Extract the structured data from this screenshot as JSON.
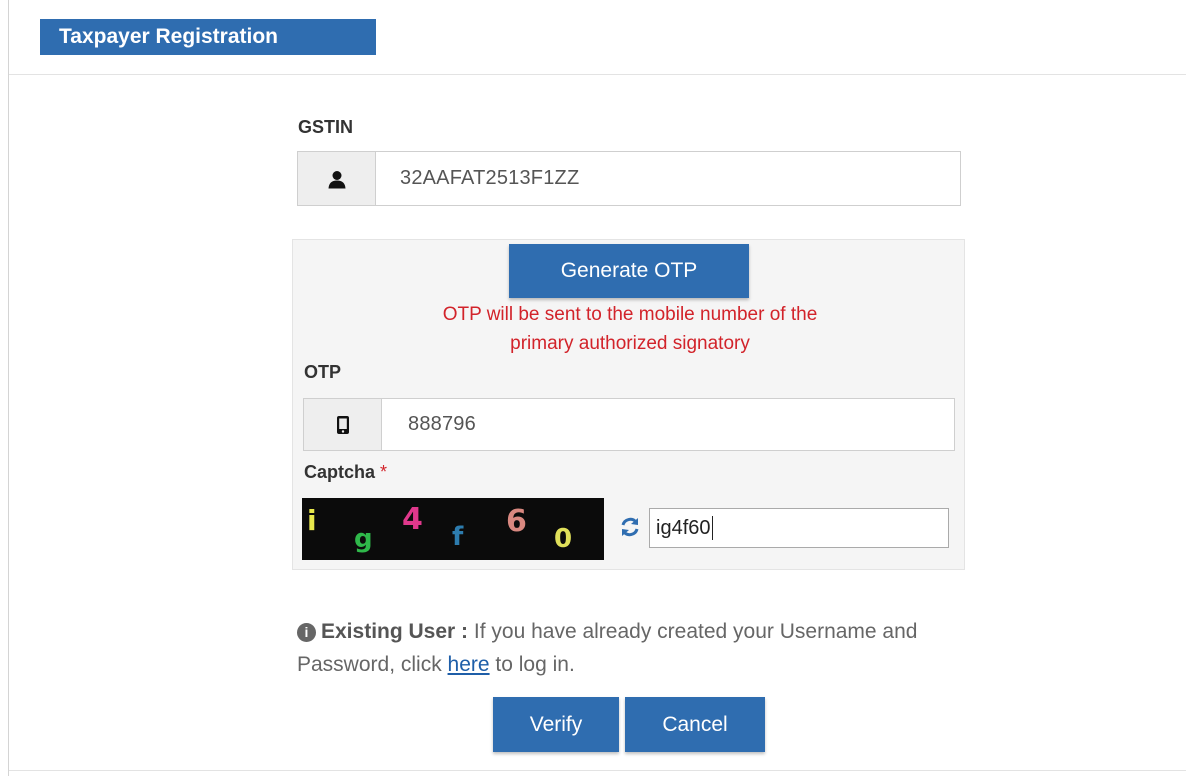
{
  "header": {
    "title": "Taxpayer Registration"
  },
  "gstin": {
    "label": "GSTIN",
    "value": "32AAFAT2513F1ZZ",
    "icon": "user-icon"
  },
  "otp_section": {
    "generate_button": "Generate OTP",
    "note_line1": "OTP will be sent to the mobile number of the",
    "note_line2": "primary authorized signatory",
    "otp_label": "OTP",
    "otp_value": "888796",
    "otp_icon": "mobile-icon"
  },
  "captcha": {
    "label": "Captcha",
    "required_mark": "*",
    "chars": [
      "i",
      "g",
      "4",
      "f",
      "6",
      "0"
    ],
    "input_value": "ig4f60",
    "refresh_icon": "refresh-icon"
  },
  "existing_user": {
    "heading": "Existing User :",
    "text_before": "If you have already created your Username and Password, click",
    "link": "here",
    "text_after": "to log in."
  },
  "actions": {
    "verify": "Verify",
    "cancel": "Cancel"
  },
  "colors": {
    "primary": "#2f6db0",
    "error": "#d2232a",
    "panel_bg": "#f5f5f5",
    "link": "#1e5ea8"
  }
}
